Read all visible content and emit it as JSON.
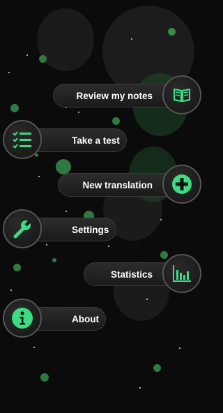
{
  "theme": {
    "accent": "#3ddc84",
    "background": "#0b0b0b"
  },
  "menu": {
    "review_notes": {
      "label": "Review my notes",
      "icon": "book-icon"
    },
    "take_test": {
      "label": "Take a test",
      "icon": "checklist-icon"
    },
    "new_translation": {
      "label": "New translation",
      "icon": "plus-icon"
    },
    "settings": {
      "label": "Settings",
      "icon": "wrench-icon"
    },
    "statistics": {
      "label": "Statistics",
      "icon": "bar-chart-icon"
    },
    "about": {
      "label": "About",
      "icon": "info-icon"
    }
  }
}
